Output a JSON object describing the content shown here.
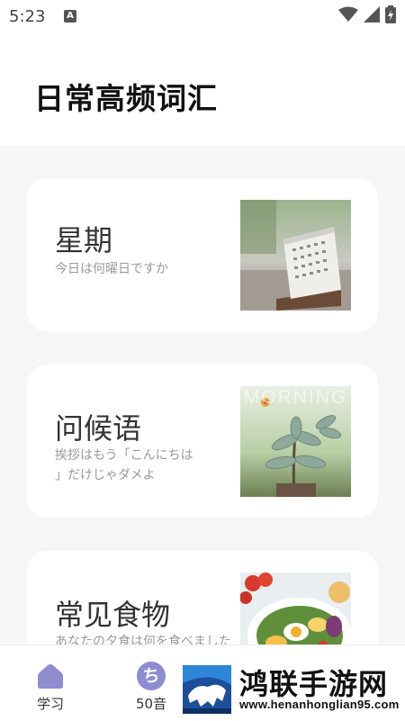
{
  "status": {
    "time": "5:23",
    "notif_letter": "A"
  },
  "header": {
    "title": "日常高频词汇"
  },
  "cards": [
    {
      "title": "星期",
      "subtitle": "今日は何曜日ですか",
      "image": "desk-calendar-photo"
    },
    {
      "title": "问候语",
      "subtitle": "挨拶はもう「こんにちは」だけじゃダメよ",
      "subtitle_line1": "挨拶はもう「こんにちは",
      "subtitle_line2": "」だけじゃダメよ",
      "image": "succulent-plant-photo",
      "image_caption": "MORNING"
    },
    {
      "title": "常见食物",
      "subtitle": "あなたの夕食は何を食べました",
      "image": "salad-plate-photo"
    }
  ],
  "tabbar": {
    "tabs": [
      {
        "label": "学习",
        "icon": "home-icon"
      },
      {
        "label": "50音",
        "icon": "kana-chi-icon",
        "icon_char": "ち"
      }
    ]
  },
  "watermark": {
    "name": "鸿联手游网",
    "url": "www.henanhonglian95.com"
  },
  "colors": {
    "accent": "#7b78c8",
    "card_bg": "#ffffff",
    "page_bg": "#f6f6f6"
  }
}
